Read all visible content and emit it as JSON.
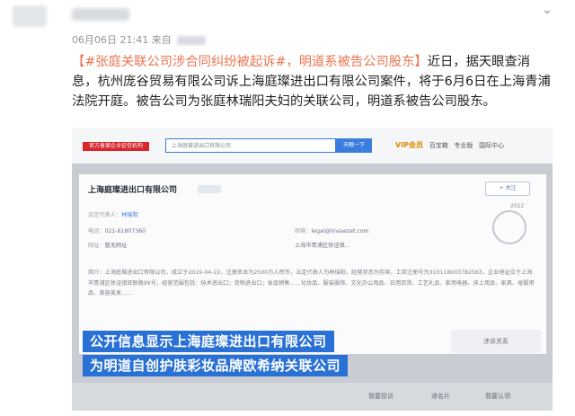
{
  "post": {
    "meta_date": "06月06日 21:41",
    "meta_from": "来自",
    "topic": "【#张庭关联公司涉合同纠纷被起诉#，明道系被告公司股东】",
    "body": "近日，据天眼查消息，杭州庞谷贸易有限公司诉上海庭璨进出口有限公司案件，将于6月6日在上海青浦法院开庭。被告公司为张庭林瑞阳夫妇的关联公司，明道系被告公司股东。"
  },
  "screenshot": {
    "logo_text": "官方备案企业征信机构",
    "search_value": "上海庭璨进出口有限公司",
    "search_button": "天眼一下",
    "nav": {
      "vip": "VIP会员",
      "item1": "百宝箱",
      "item2": "专业版",
      "item3": "国际中心"
    },
    "company": {
      "name": "上海庭璨进出口有限公司",
      "follow": "+ 关注",
      "year": "2022",
      "legal_rep_label": "法定代表人：",
      "legal_rep": "林瑞阳",
      "phone_label": "电话：",
      "phone": "021-61807360",
      "email_label": "邮箱：",
      "email": "legal@linsaezet.com",
      "website_label": "网址：",
      "website": "暂无网址",
      "address": "上海市青浦区徐泾镇…",
      "desc": "简介：上海庭璨进出口有限公司，成立于2019-04-22，注册资本为2500万人民币，法定代表人为林瑞阳，经营状态为存续，工商注册号为310118003782563，企业地址位于上海市青浦区徐泾镇双联路99号，经营范围包括：技术进出口；货物进出口；食品销售……化妆品、服装服饰、文化办公用品、日用百货、工艺礼品、家用电器、床上用品、家具、母婴用品、美容美发……"
    },
    "caption1": "公开信息显示上海庭璨进出口有限公司",
    "caption2": "为明道自创护肤彩妆品牌欧希纳关联公司",
    "bottom": {
      "item1": "我要投诉",
      "item2": "递名片",
      "item3": "我要认领"
    },
    "right_box": "涉诉关系"
  }
}
